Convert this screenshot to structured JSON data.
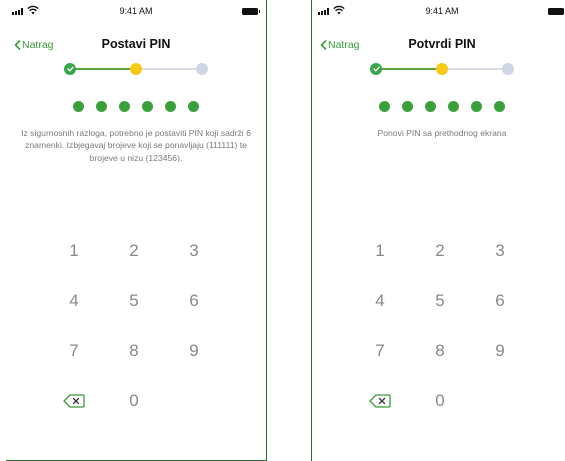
{
  "screens": [
    {
      "status_bar": {
        "time": "9:41 AM"
      },
      "nav": {
        "back_label": "Natrag",
        "title": "Postavi PIN"
      },
      "steps": [
        "done",
        "current",
        "upcoming"
      ],
      "pin_digits_entered": 6,
      "instruction": "Iz sigurnosnih razloga, potrebno je postaviti PIN koji sadrži 6 znamenki. Izbjegavaj brojeve koji se ponavljaju (111111) te brojeve u nizu (123456).",
      "keypad": [
        [
          "1",
          "2",
          "3"
        ],
        [
          "4",
          "5",
          "6"
        ],
        [
          "7",
          "8",
          "9"
        ],
        [
          "backspace",
          "0",
          ""
        ]
      ]
    },
    {
      "status_bar": {
        "time": "9:41 AM"
      },
      "nav": {
        "back_label": "Natrag",
        "title": "Potvrdi PIN"
      },
      "steps": [
        "done",
        "current",
        "upcoming"
      ],
      "pin_digits_entered": 6,
      "instruction": "Ponovi PIN sa prethodnog ekrana",
      "keypad": [
        [
          "1",
          "2",
          "3"
        ],
        [
          "4",
          "5",
          "6"
        ],
        [
          "7",
          "8",
          "9"
        ],
        [
          "backspace",
          "0",
          ""
        ]
      ]
    }
  ],
  "colors": {
    "accent_green": "#3a9a39",
    "step_current": "#f7c814",
    "step_upcoming": "#cfd6e4",
    "frame_border": "#2f6b34"
  },
  "icons": {
    "back": "chevron-left-icon",
    "step_done": "checkmark-icon",
    "backspace": "backspace-icon",
    "signal": "signal-icon",
    "wifi": "wifi-icon",
    "battery": "battery-icon"
  }
}
